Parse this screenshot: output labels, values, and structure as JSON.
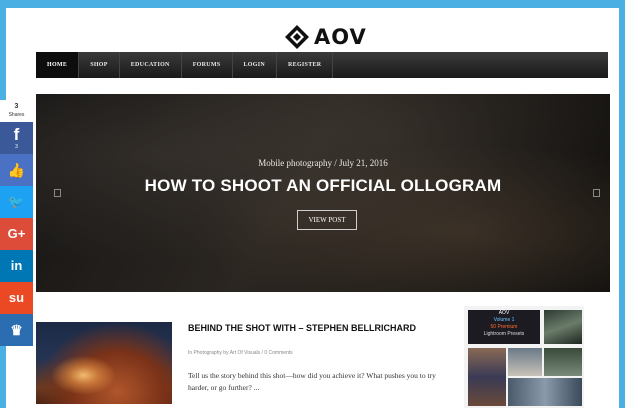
{
  "logo": {
    "text": "AOV",
    "icon": "diamond-logo-icon"
  },
  "nav": {
    "items": [
      {
        "label": "HOME",
        "active": true
      },
      {
        "label": "SHOP",
        "active": false
      },
      {
        "label": "EDUCATION",
        "active": false
      },
      {
        "label": "FORUMS",
        "active": false
      },
      {
        "label": "LOGIN",
        "active": false
      },
      {
        "label": "REGISTER",
        "active": false
      }
    ]
  },
  "share": {
    "count": "3",
    "count_label": "Shares",
    "facebook_count": "3",
    "buttons": [
      {
        "name": "facebook",
        "glyph": "f",
        "color": "#3b5998"
      },
      {
        "name": "like",
        "glyph": "👍",
        "color": "#4a71c4"
      },
      {
        "name": "twitter",
        "glyph": "🐦",
        "color": "#1da1f2"
      },
      {
        "name": "google-plus",
        "glyph": "G+",
        "color": "#dd4b39"
      },
      {
        "name": "linkedin",
        "glyph": "in",
        "color": "#0077b5"
      },
      {
        "name": "stumbleupon",
        "glyph": "su",
        "color": "#eb4924"
      },
      {
        "name": "crown",
        "glyph": "♛",
        "color": "#2b6db0"
      }
    ]
  },
  "hero": {
    "meta": "Mobile photography / July 21, 2016",
    "title": "HOW TO SHOOT AN OFFICIAL OLLOGRAM",
    "button": "VIEW POST"
  },
  "post": {
    "title": "BEHIND THE SHOT WITH – STEPHEN BELLRICHARD",
    "meta": "In Photography by Art Of Visuals  /  0 Comments",
    "excerpt": "Tell us the story behind this shot—how did you achieve it? What pushes you to try harder, or go further? ..."
  },
  "sidebar_ad": {
    "line1": "AOV",
    "line2": "Volume 1",
    "line3": "50 Premium",
    "line4": "Lightroom Presets"
  }
}
